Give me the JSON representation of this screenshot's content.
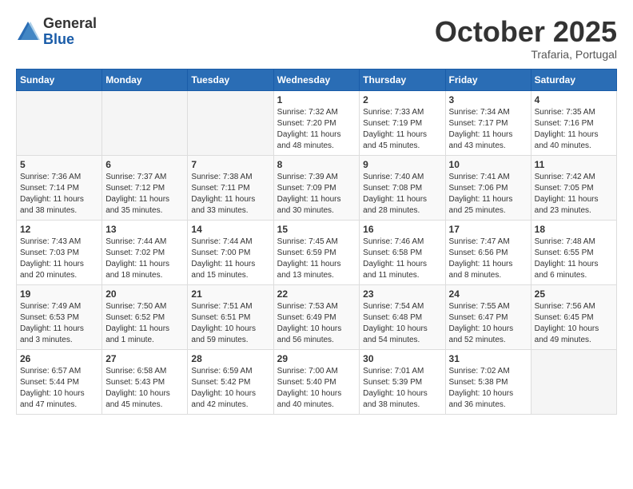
{
  "header": {
    "logo_general": "General",
    "logo_blue": "Blue",
    "month_title": "October 2025",
    "location": "Trafaria, Portugal"
  },
  "days_of_week": [
    "Sunday",
    "Monday",
    "Tuesday",
    "Wednesday",
    "Thursday",
    "Friday",
    "Saturday"
  ],
  "weeks": [
    [
      {
        "day": "",
        "info": ""
      },
      {
        "day": "",
        "info": ""
      },
      {
        "day": "",
        "info": ""
      },
      {
        "day": "1",
        "info": "Sunrise: 7:32 AM\nSunset: 7:20 PM\nDaylight: 11 hours and 48 minutes."
      },
      {
        "day": "2",
        "info": "Sunrise: 7:33 AM\nSunset: 7:19 PM\nDaylight: 11 hours and 45 minutes."
      },
      {
        "day": "3",
        "info": "Sunrise: 7:34 AM\nSunset: 7:17 PM\nDaylight: 11 hours and 43 minutes."
      },
      {
        "day": "4",
        "info": "Sunrise: 7:35 AM\nSunset: 7:16 PM\nDaylight: 11 hours and 40 minutes."
      }
    ],
    [
      {
        "day": "5",
        "info": "Sunrise: 7:36 AM\nSunset: 7:14 PM\nDaylight: 11 hours and 38 minutes."
      },
      {
        "day": "6",
        "info": "Sunrise: 7:37 AM\nSunset: 7:12 PM\nDaylight: 11 hours and 35 minutes."
      },
      {
        "day": "7",
        "info": "Sunrise: 7:38 AM\nSunset: 7:11 PM\nDaylight: 11 hours and 33 minutes."
      },
      {
        "day": "8",
        "info": "Sunrise: 7:39 AM\nSunset: 7:09 PM\nDaylight: 11 hours and 30 minutes."
      },
      {
        "day": "9",
        "info": "Sunrise: 7:40 AM\nSunset: 7:08 PM\nDaylight: 11 hours and 28 minutes."
      },
      {
        "day": "10",
        "info": "Sunrise: 7:41 AM\nSunset: 7:06 PM\nDaylight: 11 hours and 25 minutes."
      },
      {
        "day": "11",
        "info": "Sunrise: 7:42 AM\nSunset: 7:05 PM\nDaylight: 11 hours and 23 minutes."
      }
    ],
    [
      {
        "day": "12",
        "info": "Sunrise: 7:43 AM\nSunset: 7:03 PM\nDaylight: 11 hours and 20 minutes."
      },
      {
        "day": "13",
        "info": "Sunrise: 7:44 AM\nSunset: 7:02 PM\nDaylight: 11 hours and 18 minutes."
      },
      {
        "day": "14",
        "info": "Sunrise: 7:44 AM\nSunset: 7:00 PM\nDaylight: 11 hours and 15 minutes."
      },
      {
        "day": "15",
        "info": "Sunrise: 7:45 AM\nSunset: 6:59 PM\nDaylight: 11 hours and 13 minutes."
      },
      {
        "day": "16",
        "info": "Sunrise: 7:46 AM\nSunset: 6:58 PM\nDaylight: 11 hours and 11 minutes."
      },
      {
        "day": "17",
        "info": "Sunrise: 7:47 AM\nSunset: 6:56 PM\nDaylight: 11 hours and 8 minutes."
      },
      {
        "day": "18",
        "info": "Sunrise: 7:48 AM\nSunset: 6:55 PM\nDaylight: 11 hours and 6 minutes."
      }
    ],
    [
      {
        "day": "19",
        "info": "Sunrise: 7:49 AM\nSunset: 6:53 PM\nDaylight: 11 hours and 3 minutes."
      },
      {
        "day": "20",
        "info": "Sunrise: 7:50 AM\nSunset: 6:52 PM\nDaylight: 11 hours and 1 minute."
      },
      {
        "day": "21",
        "info": "Sunrise: 7:51 AM\nSunset: 6:51 PM\nDaylight: 10 hours and 59 minutes."
      },
      {
        "day": "22",
        "info": "Sunrise: 7:53 AM\nSunset: 6:49 PM\nDaylight: 10 hours and 56 minutes."
      },
      {
        "day": "23",
        "info": "Sunrise: 7:54 AM\nSunset: 6:48 PM\nDaylight: 10 hours and 54 minutes."
      },
      {
        "day": "24",
        "info": "Sunrise: 7:55 AM\nSunset: 6:47 PM\nDaylight: 10 hours and 52 minutes."
      },
      {
        "day": "25",
        "info": "Sunrise: 7:56 AM\nSunset: 6:45 PM\nDaylight: 10 hours and 49 minutes."
      }
    ],
    [
      {
        "day": "26",
        "info": "Sunrise: 6:57 AM\nSunset: 5:44 PM\nDaylight: 10 hours and 47 minutes."
      },
      {
        "day": "27",
        "info": "Sunrise: 6:58 AM\nSunset: 5:43 PM\nDaylight: 10 hours and 45 minutes."
      },
      {
        "day": "28",
        "info": "Sunrise: 6:59 AM\nSunset: 5:42 PM\nDaylight: 10 hours and 42 minutes."
      },
      {
        "day": "29",
        "info": "Sunrise: 7:00 AM\nSunset: 5:40 PM\nDaylight: 10 hours and 40 minutes."
      },
      {
        "day": "30",
        "info": "Sunrise: 7:01 AM\nSunset: 5:39 PM\nDaylight: 10 hours and 38 minutes."
      },
      {
        "day": "31",
        "info": "Sunrise: 7:02 AM\nSunset: 5:38 PM\nDaylight: 10 hours and 36 minutes."
      },
      {
        "day": "",
        "info": ""
      }
    ]
  ]
}
